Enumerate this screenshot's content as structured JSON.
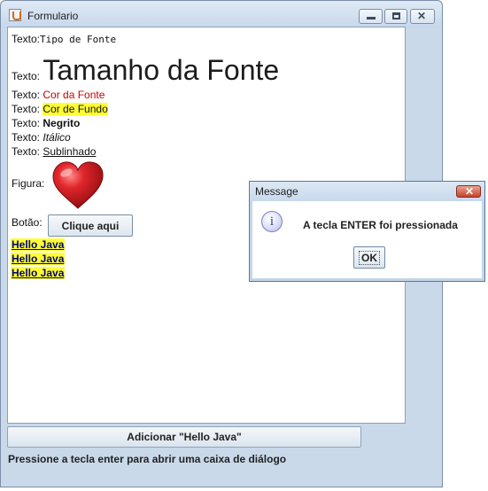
{
  "window": {
    "title": "Formulario"
  },
  "form": {
    "label_texto": "Texto:",
    "font_type_value": "Tipo de Fonte",
    "font_size_value": "Tamanho da Fonte",
    "font_color_value": "Cor da Fonte",
    "background_color_value": "Cor de Fundo",
    "bold_value": "Negrito",
    "italic_value": "Itálico",
    "underline_value": "Sublinhado",
    "figure_label": "Figura:",
    "button_label": "Botão:",
    "button_text": "Clique aqui",
    "hello_items": [
      "Hello Java",
      "Hello Java",
      "Hello Java"
    ]
  },
  "bottom": {
    "add_button": "Adicionar \"Hello Java\"",
    "status": "Pressione a tecla enter para abrir uma caixa de diálogo"
  },
  "dialog": {
    "title": "Message",
    "message": "A tecla ENTER foi pressionada",
    "ok": "OK"
  },
  "colors": {
    "font_color": "#c80000",
    "highlight": "#ffff33"
  },
  "icons": [
    "java-icon",
    "minimize-icon",
    "maximize-icon",
    "close-icon",
    "heart-icon",
    "info-icon"
  ]
}
